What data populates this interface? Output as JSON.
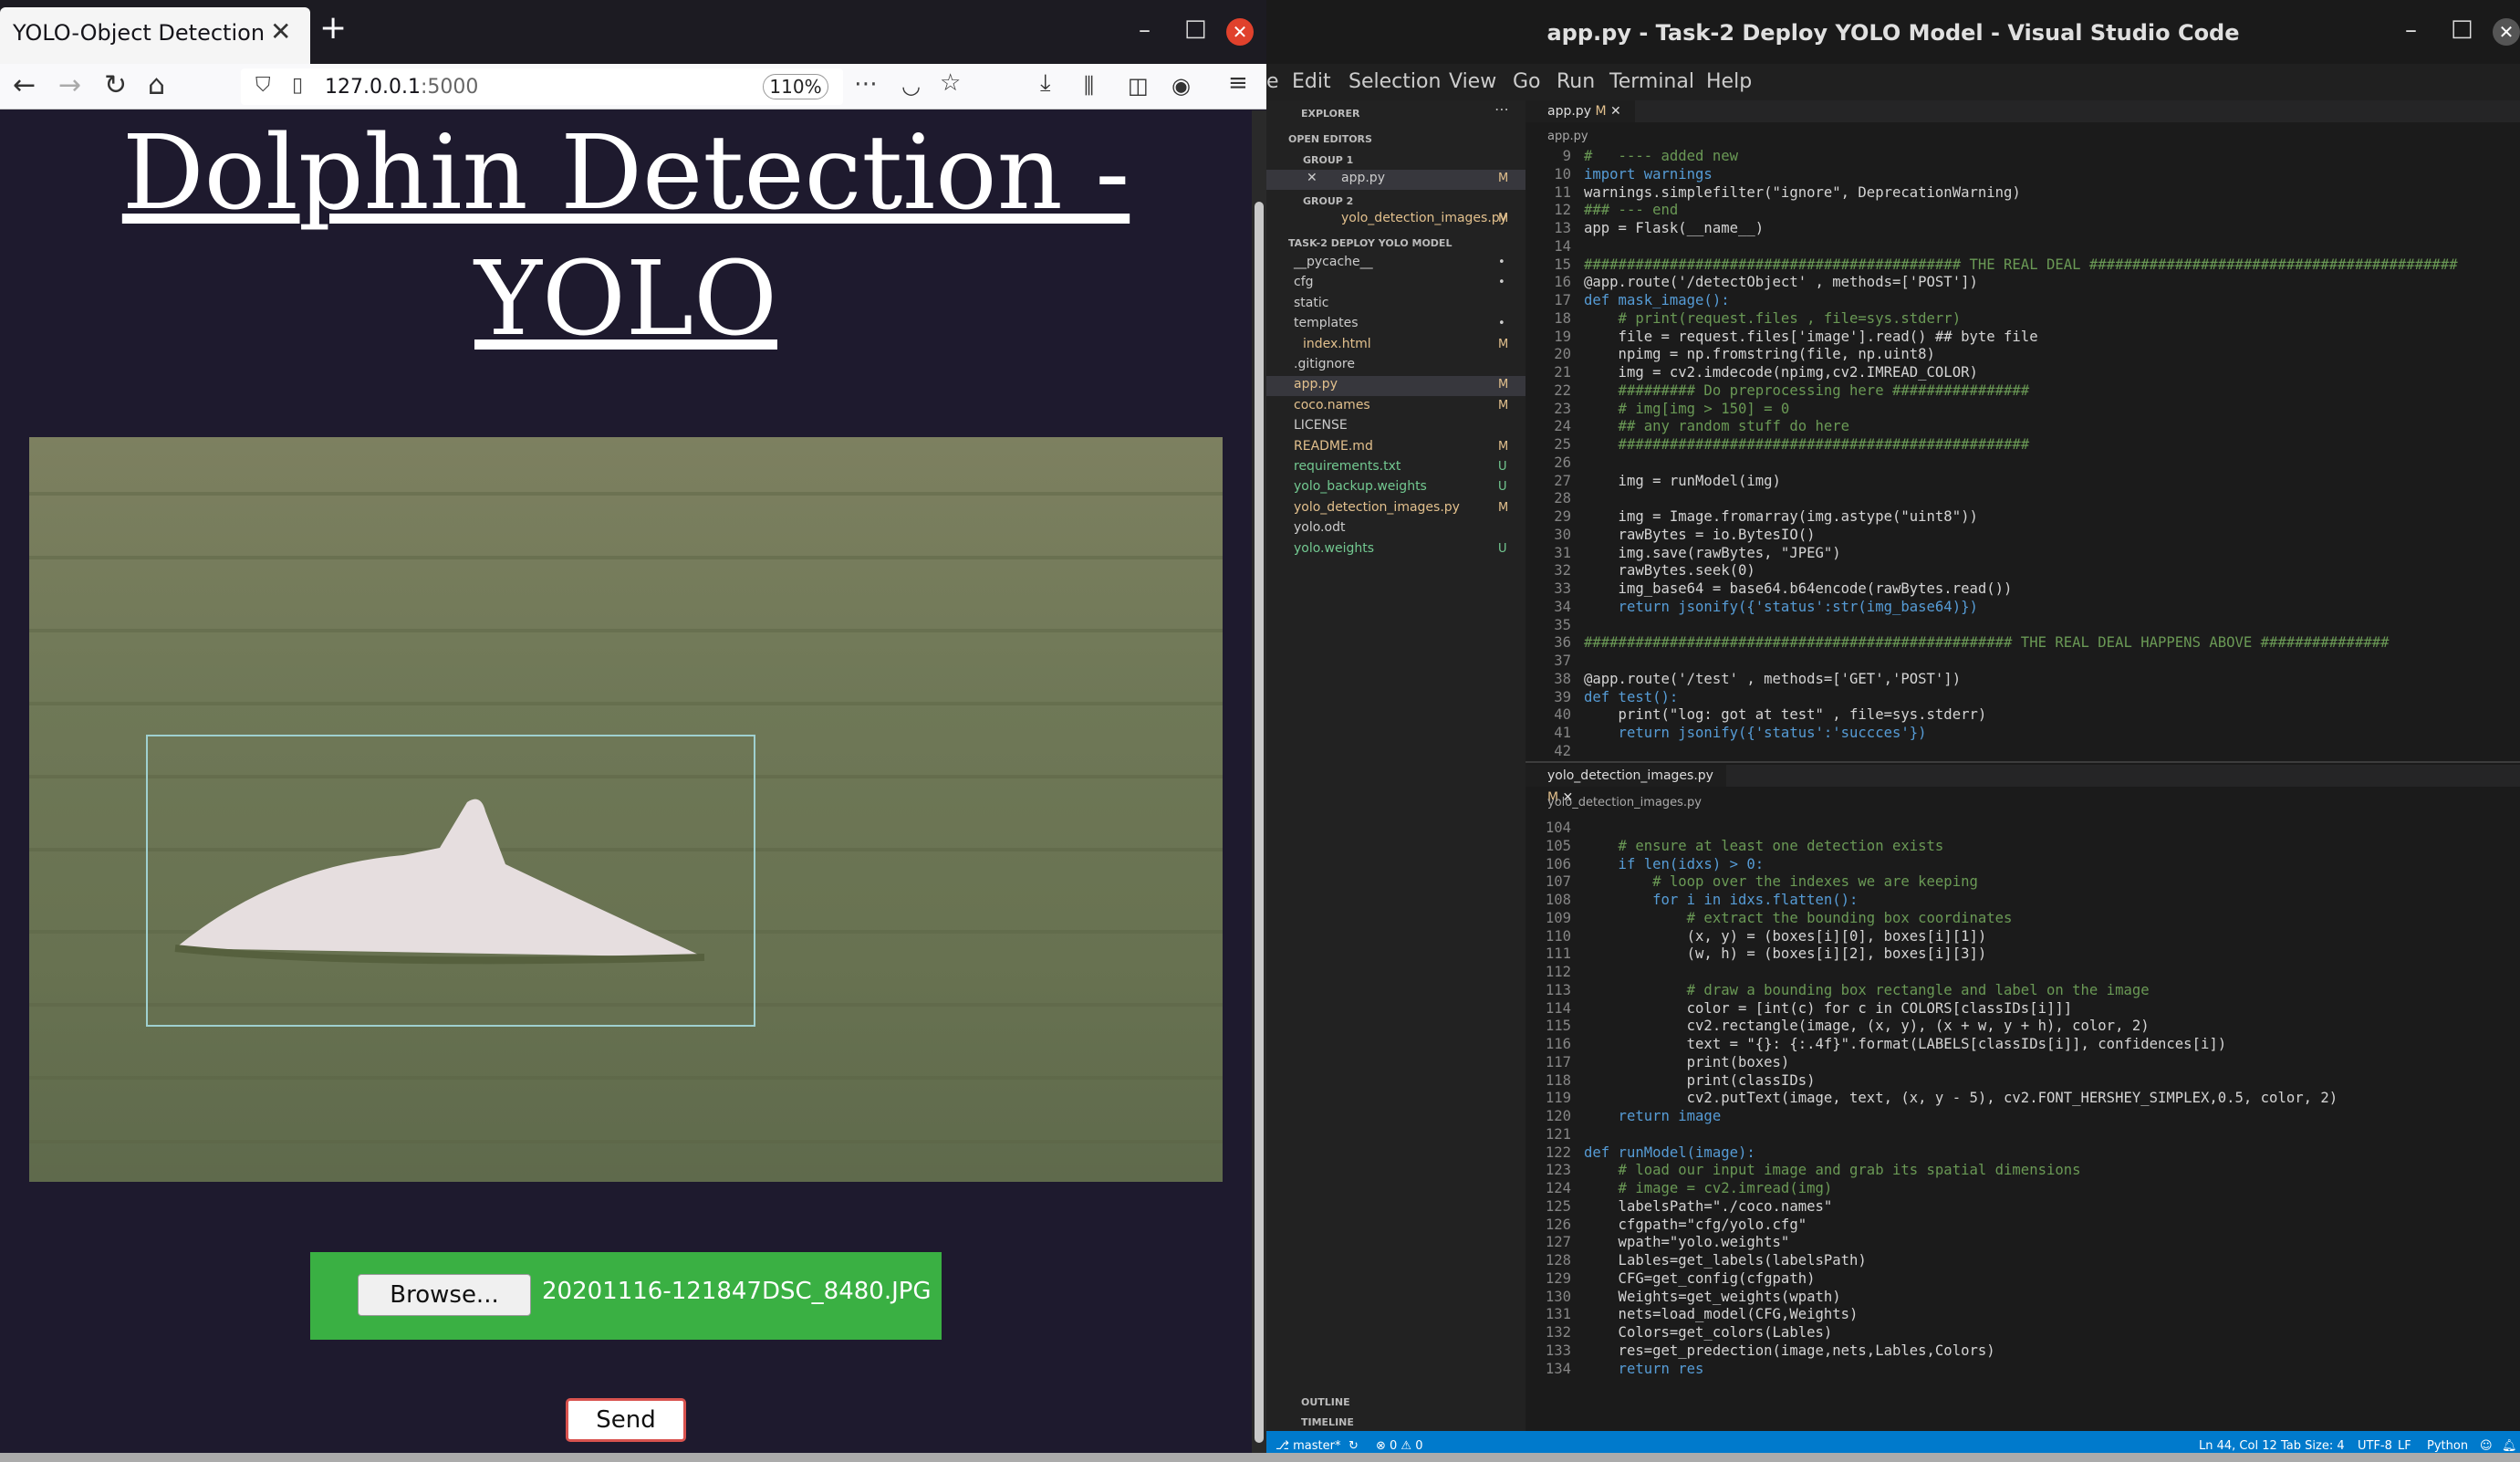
{
  "firefox": {
    "tab_title": "YOLO-Object Detection",
    "url_host": "127.0.0.1",
    "url_port": ":5000",
    "zoom": "110%",
    "page": {
      "title": "Dolphin Detection - YOLO",
      "browse_label": "Browse...",
      "file_name": "20201116-121847DSC_8480.JPG",
      "send_label": "Send"
    }
  },
  "vscode": {
    "window_title": "app.py - Task-2 Deploy YOLO Model - Visual Studio Code",
    "menu": [
      "e",
      "Edit",
      "Selection",
      "View",
      "Go",
      "Run",
      "Terminal",
      "Help"
    ],
    "explorer": {
      "header": "EXPLORER",
      "open_editors": "OPEN EDITORS",
      "group1": "GROUP 1",
      "group1_file": "app.py",
      "group2": "GROUP 2",
      "group2_file": "yolo_detection_images.py",
      "project": "TASK-2 DEPLOY YOLO MODEL",
      "items": [
        {
          "name": "__pycache__",
          "mod": "•"
        },
        {
          "name": "cfg",
          "mod": "•"
        },
        {
          "name": "static",
          "mod": ""
        },
        {
          "name": "templates",
          "mod": "•"
        },
        {
          "name": "index.html",
          "mod": "M"
        },
        {
          "name": ".gitignore",
          "mod": ""
        },
        {
          "name": "app.py",
          "mod": "M"
        },
        {
          "name": "coco.names",
          "mod": "M"
        },
        {
          "name": "LICENSE",
          "mod": ""
        },
        {
          "name": "README.md",
          "mod": "M"
        },
        {
          "name": "requirements.txt",
          "mod": "U"
        },
        {
          "name": "yolo_backup.weights",
          "mod": "U"
        },
        {
          "name": "yolo_detection_images.py",
          "mod": "M"
        },
        {
          "name": "yolo.odt",
          "mod": ""
        },
        {
          "name": "yolo.weights",
          "mod": "U"
        }
      ],
      "outline": "OUTLINE",
      "timeline": "TIMELINE"
    },
    "editor_top": {
      "tab": "app.py",
      "tab_mod": "M",
      "breadcrumb": "app.py",
      "lines": [
        [
          "9",
          "#   ---- added new"
        ],
        [
          "10",
          "import warnings"
        ],
        [
          "11",
          "warnings.simplefilter(\"ignore\", DeprecationWarning)"
        ],
        [
          "12",
          "### --- end"
        ],
        [
          "13",
          "app = Flask(__name__)"
        ],
        [
          "14",
          ""
        ],
        [
          "15",
          "############################################ THE REAL DEAL ###########################################"
        ],
        [
          "16",
          "@app.route('/detectObject' , methods=['POST'])"
        ],
        [
          "17",
          "def mask_image():"
        ],
        [
          "18",
          "    # print(request.files , file=sys.stderr)"
        ],
        [
          "19",
          "    file = request.files['image'].read() ## byte file"
        ],
        [
          "20",
          "    npimg = np.fromstring(file, np.uint8)"
        ],
        [
          "21",
          "    img = cv2.imdecode(npimg,cv2.IMREAD_COLOR)"
        ],
        [
          "22",
          "    ######### Do preprocessing here ################"
        ],
        [
          "23",
          "    # img[img > 150] = 0"
        ],
        [
          "24",
          "    ## any random stuff do here"
        ],
        [
          "25",
          "    ################################################"
        ],
        [
          "26",
          ""
        ],
        [
          "27",
          "    img = runModel(img)"
        ],
        [
          "28",
          ""
        ],
        [
          "29",
          "    img = Image.fromarray(img.astype(\"uint8\"))"
        ],
        [
          "30",
          "    rawBytes = io.BytesIO()"
        ],
        [
          "31",
          "    img.save(rawBytes, \"JPEG\")"
        ],
        [
          "32",
          "    rawBytes.seek(0)"
        ],
        [
          "33",
          "    img_base64 = base64.b64encode(rawBytes.read())"
        ],
        [
          "34",
          "    return jsonify({'status':str(img_base64)})"
        ],
        [
          "35",
          ""
        ],
        [
          "36",
          "################################################## THE REAL DEAL HAPPENS ABOVE ###############"
        ],
        [
          "37",
          ""
        ],
        [
          "38",
          "@app.route('/test' , methods=['GET','POST'])"
        ],
        [
          "39",
          "def test():"
        ],
        [
          "40",
          "    print(\"log: got at test\" , file=sys.stderr)"
        ],
        [
          "41",
          "    return jsonify({'status':'succces'})"
        ],
        [
          "42",
          ""
        ]
      ]
    },
    "editor_bottom": {
      "tab": "yolo_detection_images.py",
      "tab_mod": "M",
      "breadcrumb": "yolo_detection_images.py",
      "lines": [
        [
          "104",
          ""
        ],
        [
          "105",
          "    # ensure at least one detection exists"
        ],
        [
          "106",
          "    if len(idxs) > 0:"
        ],
        [
          "107",
          "        # loop over the indexes we are keeping"
        ],
        [
          "108",
          "        for i in idxs.flatten():"
        ],
        [
          "109",
          "            # extract the bounding box coordinates"
        ],
        [
          "110",
          "            (x, y) = (boxes[i][0], boxes[i][1])"
        ],
        [
          "111",
          "            (w, h) = (boxes[i][2], boxes[i][3])"
        ],
        [
          "112",
          ""
        ],
        [
          "113",
          "            # draw a bounding box rectangle and label on the image"
        ],
        [
          "114",
          "            color = [int(c) for c in COLORS[classIDs[i]]]"
        ],
        [
          "115",
          "            cv2.rectangle(image, (x, y), (x + w, y + h), color, 2)"
        ],
        [
          "116",
          "            text = \"{}: {:.4f}\".format(LABELS[classIDs[i]], confidences[i])"
        ],
        [
          "117",
          "            print(boxes)"
        ],
        [
          "118",
          "            print(classIDs)"
        ],
        [
          "119",
          "            cv2.putText(image, text, (x, y - 5), cv2.FONT_HERSHEY_SIMPLEX,0.5, color, 2)"
        ],
        [
          "120",
          "    return image"
        ],
        [
          "121",
          ""
        ],
        [
          "122",
          "def runModel(image):"
        ],
        [
          "123",
          "    # load our input image and grab its spatial dimensions"
        ],
        [
          "124",
          "    # image = cv2.imread(img)"
        ],
        [
          "125",
          "    labelsPath=\"./coco.names\""
        ],
        [
          "126",
          "    cfgpath=\"cfg/yolo.cfg\""
        ],
        [
          "127",
          "    wpath=\"yolo.weights\""
        ],
        [
          "128",
          "    Lables=get_labels(labelsPath)"
        ],
        [
          "129",
          "    CFG=get_config(cfgpath)"
        ],
        [
          "130",
          "    Weights=get_weights(wpath)"
        ],
        [
          "131",
          "    nets=load_model(CFG,Weights)"
        ],
        [
          "132",
          "    Colors=get_colors(Lables)"
        ],
        [
          "133",
          "    res=get_predection(image,nets,Lables,Colors)"
        ],
        [
          "134",
          "    return res"
        ]
      ]
    },
    "status": {
      "branch": "master*",
      "errors": "⊗ 0 ⚠ 0",
      "position": "Ln 44, Col 12",
      "tab_size": "Tab Size: 4",
      "encoding": "UTF-8",
      "eol": "LF",
      "language": "Python"
    }
  }
}
